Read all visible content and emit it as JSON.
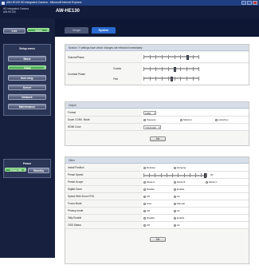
{
  "window": {
    "title": "AW-HE130 HD Integrated Camera - Microsoft Internet Explorer"
  },
  "header": {
    "brand_line1": "HD Integrated Camera",
    "brand_line2": "AW-HE130",
    "model": "AW-HE130"
  },
  "sidebar": {
    "mode_tabs": [
      "Live",
      "Setup"
    ],
    "setup_menu_title": "Setup menu",
    "menu_items": [
      "Basic",
      "Image",
      "User mng.",
      "Server",
      "Network",
      "Maintenance"
    ],
    "power_title": "Power",
    "power_buttons": [
      "Power ON",
      "Standby"
    ]
  },
  "tabs": [
    "Image",
    "System"
  ],
  "system": {
    "title": "Section: Y settings have which changes are reflected immediately",
    "rows": [
      {
        "label": "Volume/Phase",
        "value_text": ""
      },
      {
        "label": "Contrast Phase",
        "sub1": "Coarse",
        "sub2": "Fine",
        "value_text": ""
      }
    ]
  },
  "output": {
    "title": "Output",
    "format_label": "Format",
    "format_value": "1080i",
    "down_conv_label": "Down CONV. Mode",
    "down_conv_options": [
      "Squeeze",
      "SideCut",
      "Letterbox"
    ],
    "down_conv_selected": 1,
    "hdmi_label": "HDMI Color",
    "hdmi_value": "YCbCr422",
    "set_label": "Set"
  },
  "other": {
    "title": "Other",
    "rows": [
      {
        "label": "Install Position",
        "options": [
          "Desktop",
          "Hanging"
        ],
        "selected": 0
      },
      {
        "label": "Preset Speed",
        "value_text": "30"
      },
      {
        "label": "Preset Scope",
        "options": [
          "Mode A",
          "Mode B",
          "Mode C"
        ],
        "selected": 0
      },
      {
        "label": "Digital Zoom",
        "options": [
          "Disable",
          "Enable"
        ],
        "selected": 0
      },
      {
        "label": "Speed With Zoom POS.",
        "options": [
          "Off",
          "On"
        ],
        "selected": 0
      },
      {
        "label": "Focus Mode",
        "options": [
          "Auto",
          "Manual"
        ],
        "selected": 0
      },
      {
        "label": "Privacy mode",
        "options": [
          "Off",
          "On"
        ],
        "selected": 0
      },
      {
        "label": "Tally Enable",
        "options": [
          "Disable",
          "Enable"
        ],
        "selected": 0
      },
      {
        "label": "OSD Status",
        "options": [
          "Off",
          "On"
        ],
        "selected": 0
      }
    ],
    "set_label": "Set"
  }
}
